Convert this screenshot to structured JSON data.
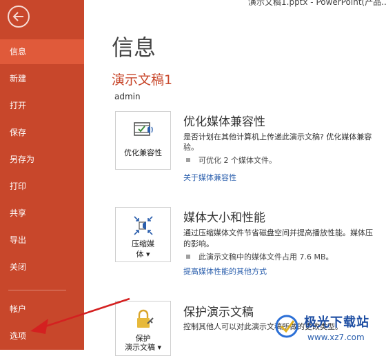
{
  "window": {
    "title": "演示文稿1.pptx - PowerPoint(产品..."
  },
  "sidebar": {
    "items": [
      {
        "label": "信息"
      },
      {
        "label": "新建"
      },
      {
        "label": "打开"
      },
      {
        "label": "保存"
      },
      {
        "label": "另存为"
      },
      {
        "label": "打印"
      },
      {
        "label": "共享"
      },
      {
        "label": "导出"
      },
      {
        "label": "关闭"
      },
      {
        "label": "帐户"
      },
      {
        "label": "选项"
      }
    ],
    "active_index": 0,
    "accent": "#c8472b",
    "active_color": "#e05a3a"
  },
  "main": {
    "page_title": "信息",
    "doc_title": "演示文稿1",
    "author": "admin",
    "sections": [
      {
        "tile_label": "优化兼容性",
        "title": "优化媒体兼容性",
        "desc1": "是否计划在其他计算机上传递此演示文稿? 优化媒体兼容",
        "desc2": "验。",
        "bullet": "可优化 2 个媒体文件。",
        "link": "关于媒体兼容性"
      },
      {
        "tile_label1": "压缩媒",
        "tile_label2": "体 ▾",
        "title": "媒体大小和性能",
        "desc1": "通过压缩媒体文件节省磁盘空间并提高播放性能。媒体压",
        "desc2": "的影响。",
        "bullet": "此演示文稿中的媒体文件占用 7.6 MB。",
        "link": "提高媒体性能的其他方式"
      },
      {
        "tile_label1": "保护",
        "tile_label2": "演示文稿 ▾",
        "title": "保护演示文稿",
        "desc1": "控制其他人可以对此演示文稿所做的更改类型。"
      }
    ]
  },
  "watermark": {
    "text": "极光下载站",
    "url": "www.xz7.com"
  }
}
